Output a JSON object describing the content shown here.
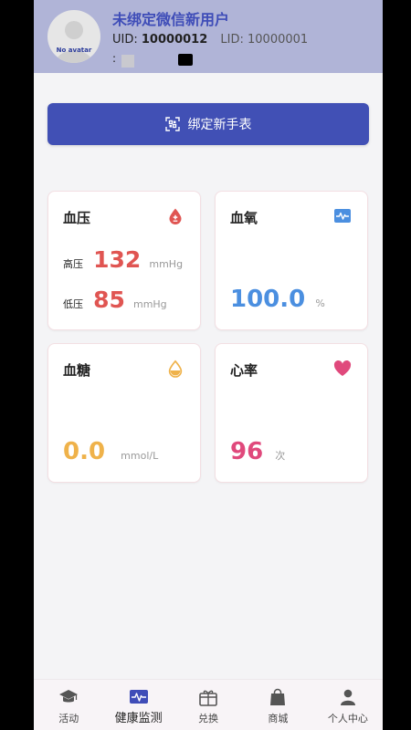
{
  "header": {
    "avatar_label": "No avatar",
    "nickname": "未绑定微信新用户",
    "uid_label": "UID:",
    "uid_value": "10000012",
    "lid_label": "LID:",
    "lid_value": "10000001",
    "third_line": ":"
  },
  "bind_button": {
    "label": "绑定新手表",
    "icon": "qr-scan-icon"
  },
  "cards": {
    "blood_pressure": {
      "title": "血压",
      "icon": "blood-drop-icon",
      "systolic_label": "高压",
      "systolic_value": "132",
      "diastolic_label": "低压",
      "diastolic_value": "85",
      "unit": "mmHg",
      "color": "#e05552"
    },
    "blood_oxygen": {
      "title": "血氧",
      "icon": "pulse-monitor-icon",
      "value": "100.0",
      "unit": "%",
      "color": "#4b8fe0"
    },
    "blood_sugar": {
      "title": "血糖",
      "icon": "water-drop-icon",
      "value": "0.0",
      "unit": "mmol/L",
      "color": "#efb24a"
    },
    "heart_rate": {
      "title": "心率",
      "icon": "heart-icon",
      "value": "96",
      "unit": "次",
      "color": "#e0497c"
    }
  },
  "tabbar": {
    "items": [
      {
        "label": "活动",
        "icon": "graduation-cap-icon"
      },
      {
        "label": "健康监测",
        "icon": "health-monitor-icon",
        "active": true
      },
      {
        "label": "兑换",
        "icon": "gift-icon"
      },
      {
        "label": "商城",
        "icon": "shopping-bag-icon"
      },
      {
        "label": "个人中心",
        "icon": "person-icon"
      }
    ]
  },
  "colors": {
    "header_bg": "#b0b4d7",
    "primary": "#4150b5",
    "page_bg": "#f4f4f6"
  }
}
